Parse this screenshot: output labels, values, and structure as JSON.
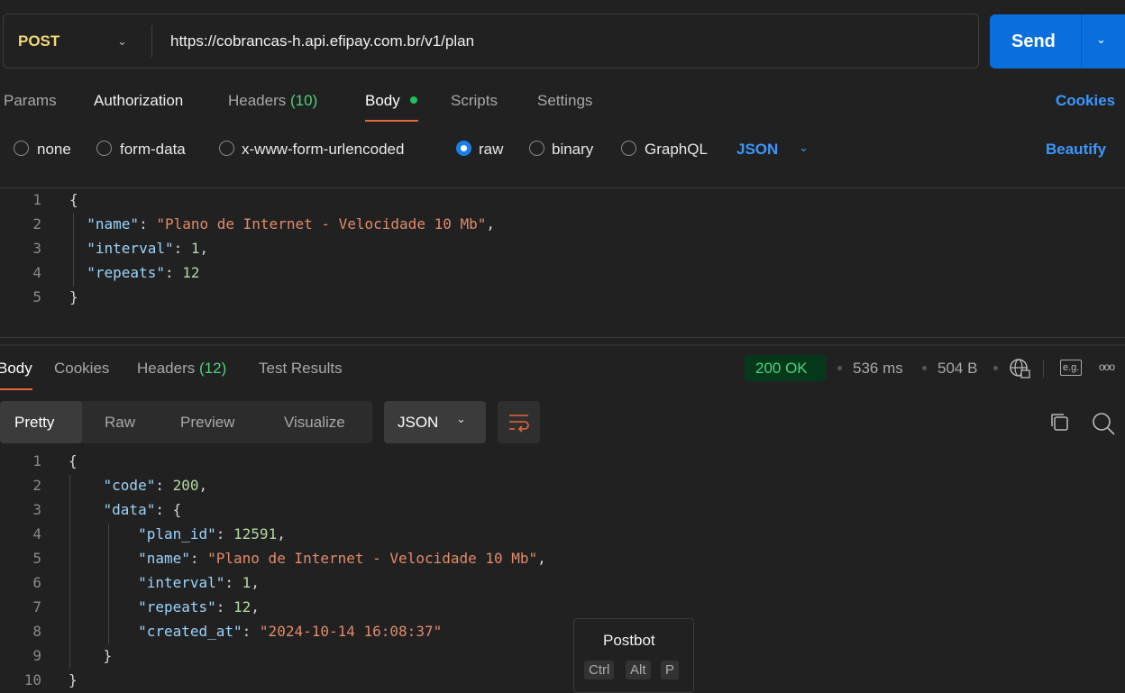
{
  "request": {
    "method": "POST",
    "url": "https://cobrancas-h.api.efipay.com.br/v1/plan",
    "send_label": "Send"
  },
  "req_tabs": {
    "params": "Params",
    "authorization": "Authorization",
    "headers": "Headers",
    "headers_count": "(10)",
    "body": "Body",
    "scripts": "Scripts",
    "settings": "Settings",
    "cookies": "Cookies"
  },
  "body_types": {
    "none": "none",
    "form_data": "form-data",
    "urlencoded": "x-www-form-urlencoded",
    "raw": "raw",
    "binary": "binary",
    "graphql": "GraphQL",
    "format": "JSON",
    "beautify": "Beautify",
    "selected": "raw"
  },
  "request_body": [
    [
      [
        "p",
        "{"
      ]
    ],
    [
      [
        "p",
        "  "
      ],
      [
        "k",
        "\"name\""
      ],
      [
        "p",
        ": "
      ],
      [
        "s",
        "\"Plano de Internet - Velocidade 10 Mb\""
      ],
      [
        "p",
        ","
      ]
    ],
    [
      [
        "p",
        "  "
      ],
      [
        "k",
        "\"interval\""
      ],
      [
        "p",
        ": "
      ],
      [
        "n",
        "1"
      ],
      [
        "p",
        ","
      ]
    ],
    [
      [
        "p",
        "  "
      ],
      [
        "k",
        "\"repeats\""
      ],
      [
        "p",
        ": "
      ],
      [
        "n",
        "12"
      ]
    ],
    [
      [
        "p",
        "}"
      ]
    ]
  ],
  "response": {
    "tabs": {
      "body": "Body",
      "cookies": "Cookies",
      "headers": "Headers",
      "headers_count": "(12)",
      "tests": "Test Results"
    },
    "status": "200 OK",
    "time": "536 ms",
    "size": "504 B",
    "views": {
      "pretty": "Pretty",
      "raw": "Raw",
      "preview": "Preview",
      "visualize": "Visualize",
      "format": "JSON"
    },
    "body": [
      [
        [
          "p",
          "{"
        ]
      ],
      [
        [
          "p",
          "    "
        ],
        [
          "k",
          "\"code\""
        ],
        [
          "p",
          ": "
        ],
        [
          "n",
          "200"
        ],
        [
          "p",
          ","
        ]
      ],
      [
        [
          "p",
          "    "
        ],
        [
          "k",
          "\"data\""
        ],
        [
          "p",
          ": {"
        ]
      ],
      [
        [
          "p",
          "        "
        ],
        [
          "k",
          "\"plan_id\""
        ],
        [
          "p",
          ": "
        ],
        [
          "n",
          "12591"
        ],
        [
          "p",
          ","
        ]
      ],
      [
        [
          "p",
          "        "
        ],
        [
          "k",
          "\"name\""
        ],
        [
          "p",
          ": "
        ],
        [
          "s",
          "\"Plano de Internet - Velocidade 10 Mb\""
        ],
        [
          "p",
          ","
        ]
      ],
      [
        [
          "p",
          "        "
        ],
        [
          "k",
          "\"interval\""
        ],
        [
          "p",
          ": "
        ],
        [
          "n",
          "1"
        ],
        [
          "p",
          ","
        ]
      ],
      [
        [
          "p",
          "        "
        ],
        [
          "k",
          "\"repeats\""
        ],
        [
          "p",
          ": "
        ],
        [
          "n",
          "12"
        ],
        [
          "p",
          ","
        ]
      ],
      [
        [
          "p",
          "        "
        ],
        [
          "k",
          "\"created_at\""
        ],
        [
          "p",
          ": "
        ],
        [
          "s",
          "\"2024-10-14 16:08:37\""
        ]
      ],
      [
        [
          "p",
          "    }"
        ]
      ],
      [
        [
          "p",
          "}"
        ]
      ]
    ]
  },
  "postbot": {
    "title": "Postbot",
    "keys": [
      "Ctrl",
      "Alt",
      "P"
    ]
  },
  "colors": {
    "accent": "#0a6fdc",
    "status_ok_bg": "#05391a",
    "status_ok_text": "#4ed17e",
    "tab_underline": "#e5673c"
  }
}
